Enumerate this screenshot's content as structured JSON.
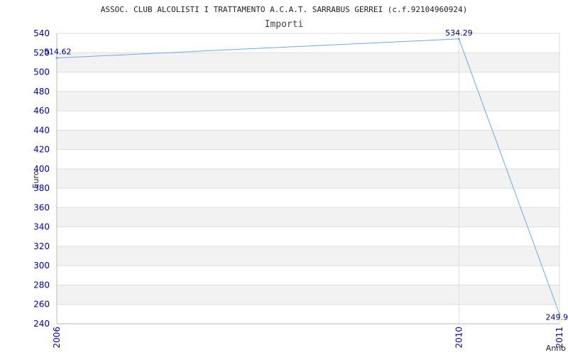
{
  "chart_data": {
    "type": "line",
    "title": "ASSOC. CLUB ALCOLISTI I TRATTAMENTO A.C.A.T. SARRABUS GERREI (c.f.92104960924)",
    "subtitle": "Importi",
    "xlabel": "Anno",
    "ylabel": "Euro",
    "categories": [
      "2006",
      "2010",
      "2011"
    ],
    "series": [
      {
        "values": [
          514.62,
          534.29,
          249.9
        ],
        "labels": [
          "514.62",
          "534.29",
          "249.9"
        ]
      }
    ],
    "ylim": [
      240,
      540
    ],
    "ytick_step": 20,
    "grid": true,
    "colors": {
      "line": "#6aaaf0",
      "band": "#f2f2f2",
      "grid": "#dddddd",
      "tick": "#0000bb",
      "label": "#000088"
    }
  }
}
